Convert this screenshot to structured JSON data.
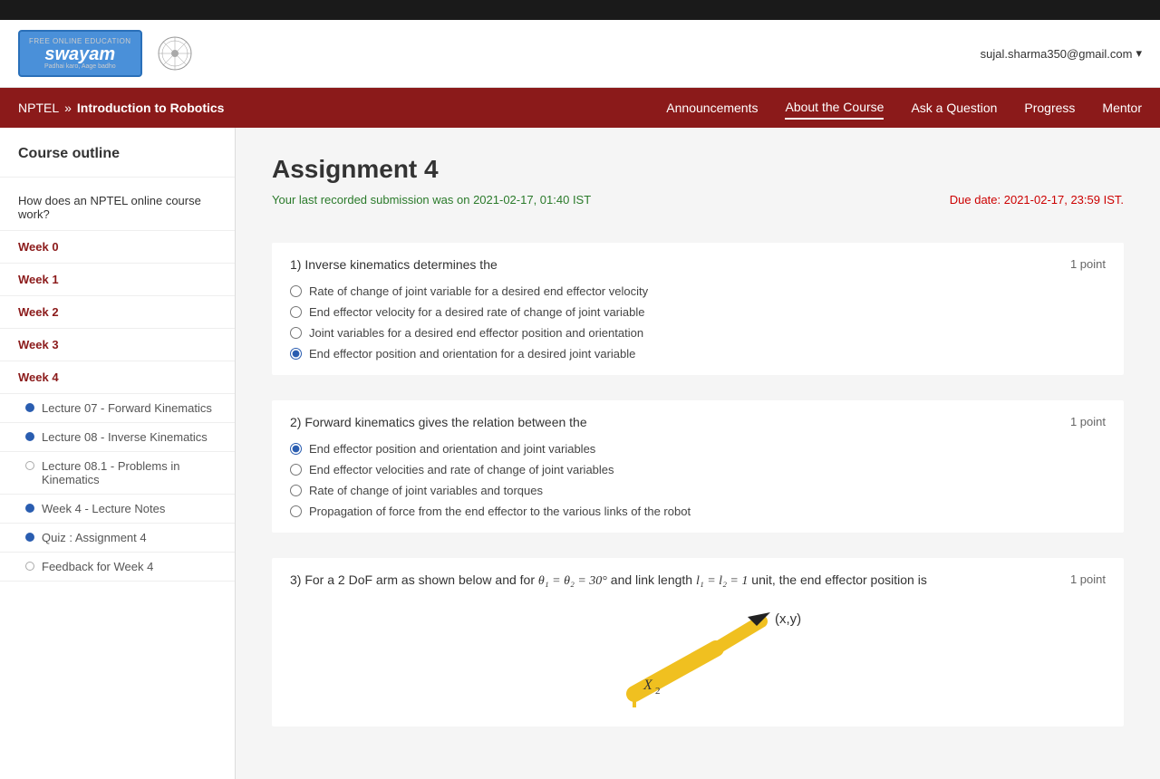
{
  "topBar": {},
  "header": {
    "logoAlt": "SWAYAM",
    "logoTopText": "FREE ONLINE EDUCATION",
    "logoMainText": "swayam",
    "logoBottomText": "Padhai karo, Aage badho",
    "userEmail": "sujal.sharma350@gmail.com"
  },
  "nav": {
    "breadcrumb": {
      "root": "NPTEL",
      "separator": "»",
      "course": "Introduction to Robotics"
    },
    "links": [
      {
        "label": "Announcements",
        "active": false
      },
      {
        "label": "About the Course",
        "active": true
      },
      {
        "label": "Ask a Question",
        "active": false
      },
      {
        "label": "Progress",
        "active": false
      },
      {
        "label": "Mentor",
        "active": false
      }
    ]
  },
  "sidebar": {
    "title": "Course outline",
    "items": [
      {
        "label": "How does an NPTEL online course work?",
        "type": "link"
      },
      {
        "label": "Week 0",
        "type": "week"
      },
      {
        "label": "Week 1",
        "type": "week"
      },
      {
        "label": "Week 2",
        "type": "week"
      },
      {
        "label": "Week 3",
        "type": "week"
      },
      {
        "label": "Week 4",
        "type": "week"
      }
    ],
    "lectures": [
      {
        "label": "Lecture 07 - Forward Kinematics",
        "dot": "filled"
      },
      {
        "label": "Lecture 08 - Inverse Kinematics",
        "dot": "filled"
      },
      {
        "label": "Lecture 08.1 - Problems in Kinematics",
        "dot": "empty"
      },
      {
        "label": "Week 4 - Lecture Notes",
        "dot": "filled"
      },
      {
        "label": "Quiz : Assignment 4",
        "dot": "filled"
      },
      {
        "label": "Feedback for Week 4",
        "dot": "empty"
      }
    ]
  },
  "assignment": {
    "title": "Assignment 4",
    "submissionInfo": "Your last recorded submission was on 2021-02-17, 01:40 IST",
    "dueDate": "Due date: 2021-02-17, 23:59 IST.",
    "questions": [
      {
        "number": "1)",
        "text": "Inverse kinematics determines the",
        "points": "1 point",
        "options": [
          {
            "text": "Rate of change of joint variable for a desired end effector velocity",
            "selected": false
          },
          {
            "text": "End effector velocity for a desired rate of change of joint variable",
            "selected": false
          },
          {
            "text": "Joint variables for a desired end effector position and orientation",
            "selected": false
          },
          {
            "text": "End effector position and orientation for a desired joint variable",
            "selected": true
          }
        ]
      },
      {
        "number": "2)",
        "text": "Forward kinematics gives the relation between the",
        "points": "1 point",
        "options": [
          {
            "text": "End effector position and orientation and joint variables",
            "selected": true
          },
          {
            "text": "End effector velocities and rate of change of joint variables",
            "selected": false
          },
          {
            "text": "Rate of change of joint variables and torques",
            "selected": false
          },
          {
            "text": "Propagation of force from the end effector to the various links of the robot",
            "selected": false
          }
        ]
      },
      {
        "number": "3)",
        "text": "For a 2 DoF arm as shown below and for θ₁ = θ₂ = 30° and link length l₁ = l₂ = 1 unit, the end effector position is",
        "points": "1 point"
      }
    ]
  },
  "q3diagram": {
    "label": "(x,y)",
    "x2label": "X₂"
  }
}
